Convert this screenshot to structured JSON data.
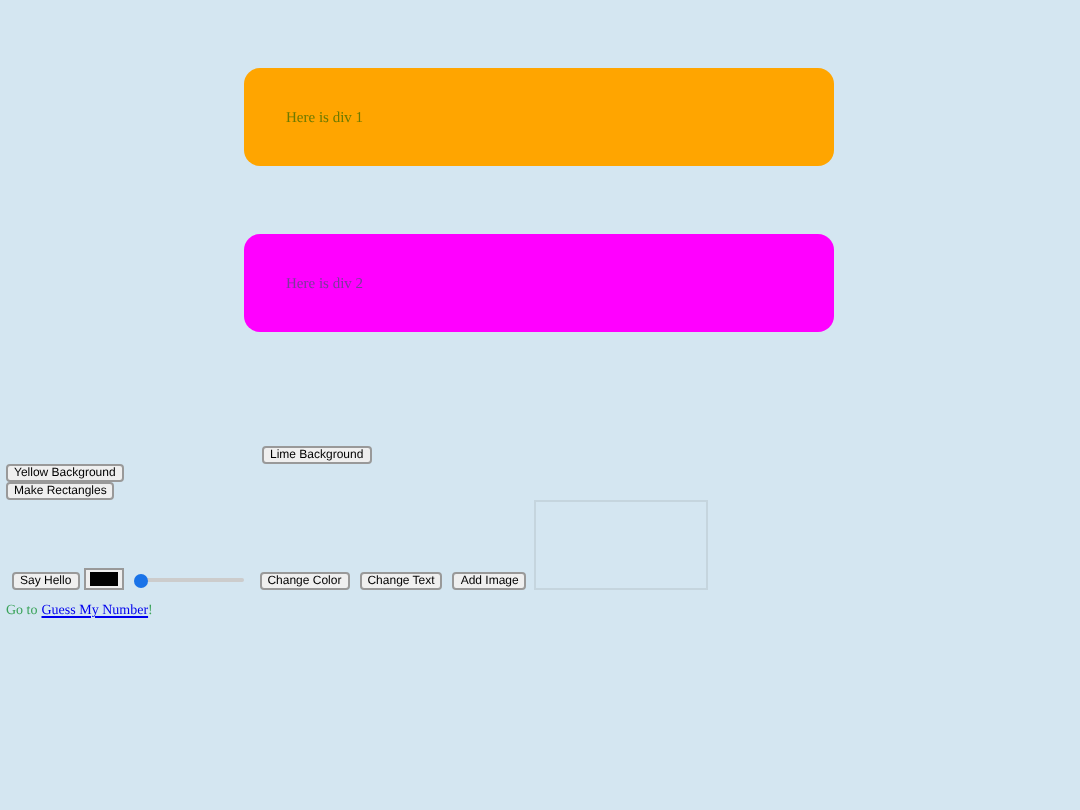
{
  "divs": [
    {
      "text": "Here is div 1",
      "kind": "orange"
    },
    {
      "text": "Here is div 2",
      "kind": "magenta"
    }
  ],
  "buttons_top": [
    "Lime Background",
    "Yellow Background",
    "Make Rectangles"
  ],
  "controls": {
    "say_hello": "Say Hello",
    "color_picker": {
      "color": "#000000"
    },
    "slider": {
      "level": 0
    },
    "buttons": [
      "Change Color",
      "Change Text",
      "Add Image"
    ]
  },
  "link_line": {
    "prefix": "Go to",
    "link": "Guess My Number",
    "suffix": "!"
  }
}
